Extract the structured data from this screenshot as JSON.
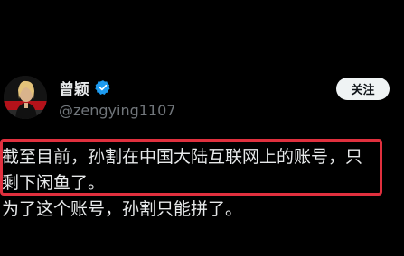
{
  "author": {
    "display_name": "曾颖",
    "handle": "@zengying1107",
    "verified": true
  },
  "follow_button": {
    "label": "关注"
  },
  "tweet": {
    "lines": [
      "截至目前，孙割在中国大陆互联网上的账号，只",
      "剩下闲鱼了。",
      "为了这个账号，孙割只能拼了。"
    ]
  },
  "colors": {
    "background": "#000000",
    "verified_badge": "#1d9bf0",
    "highlight_border": "#e0303e",
    "handle_text": "#71767b",
    "follow_button_bg": "#eff3f4"
  },
  "icons": {
    "verified": "verified-badge-icon"
  }
}
